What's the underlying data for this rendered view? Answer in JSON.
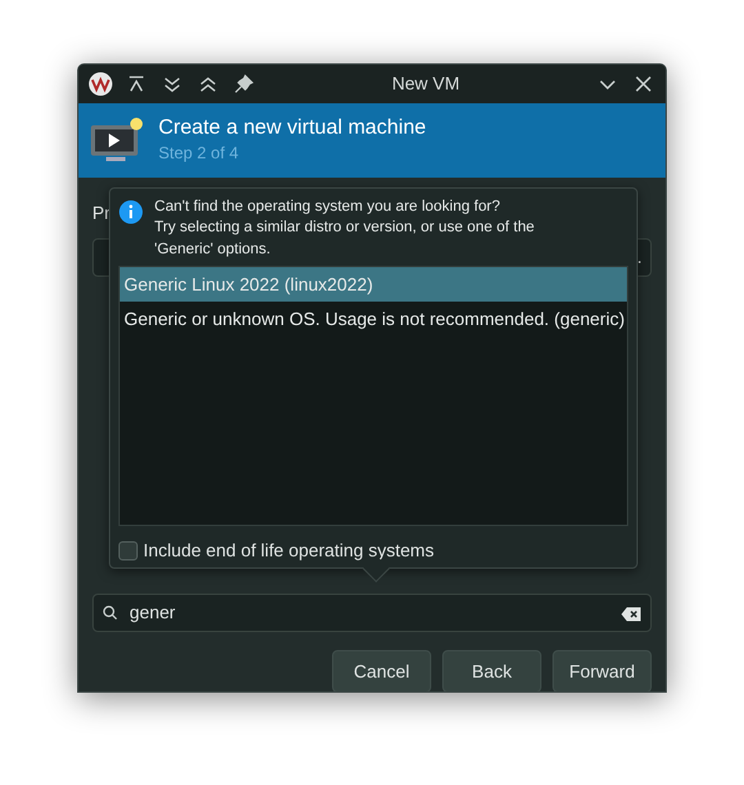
{
  "window": {
    "title": "New VM"
  },
  "header": {
    "title": "Create a new virtual machine",
    "subtitle": "Step 2 of 4"
  },
  "form": {
    "label_1": "Pr",
    "field_1_end": "."
  },
  "popover": {
    "message": "Can't find the operating system you are looking for?\nTry selecting a similar distro or version, or use one of the\n'Generic' options.",
    "items": [
      {
        "label": "Generic Linux 2022 (linux2022)",
        "selected": true
      },
      {
        "label": "Generic or unknown OS. Usage is not recommended. (generic)",
        "selected": false
      }
    ],
    "eol_checkbox": {
      "label": "Include end of life operating systems",
      "checked": false
    }
  },
  "search": {
    "value": "gener"
  },
  "buttons": [
    "Cancel",
    "Back",
    "Forward"
  ]
}
